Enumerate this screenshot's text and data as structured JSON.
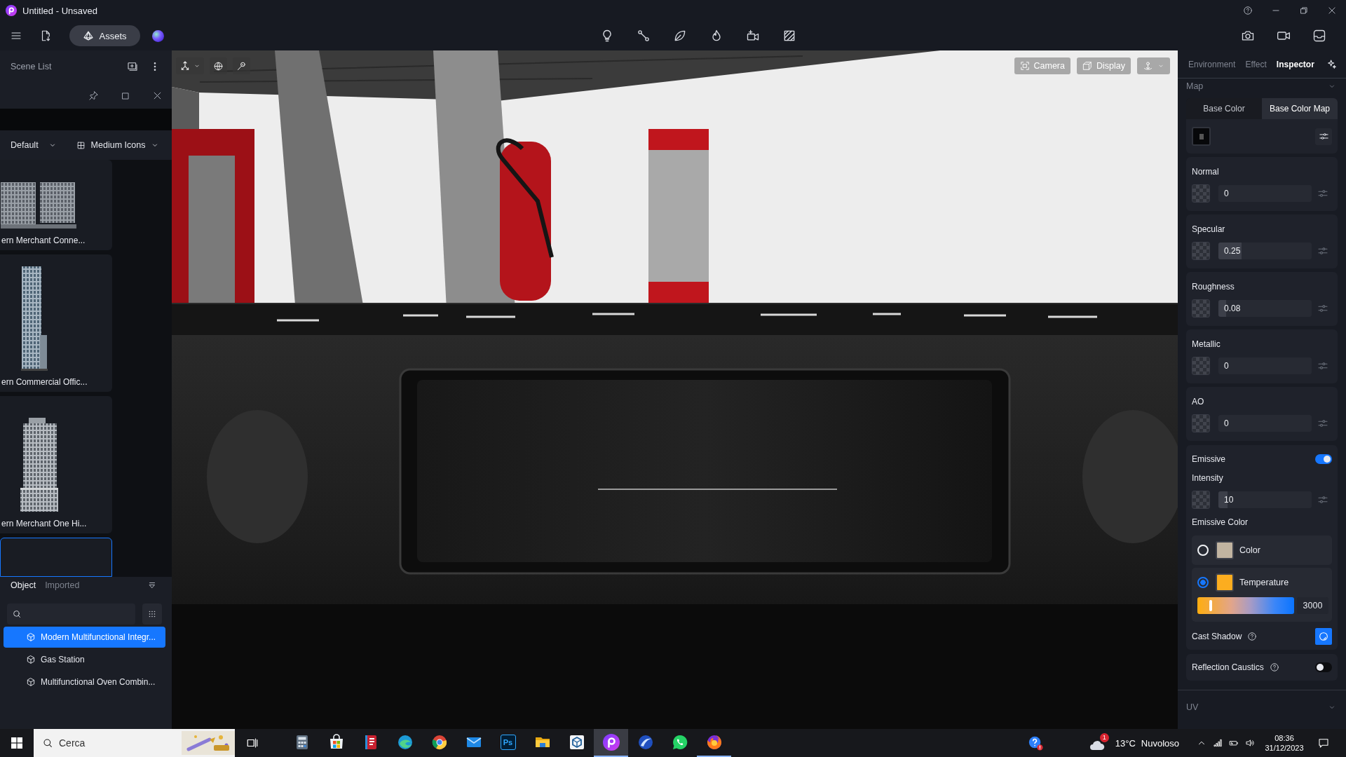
{
  "window": {
    "title": "Untitled - Unsaved"
  },
  "toolbar": {
    "assets_button": "Assets"
  },
  "scene_list": {
    "title": "Scene List"
  },
  "assets_popup": {
    "filter": "Default",
    "view": "Medium Icons",
    "items": [
      {
        "kind": "wide",
        "label": "ern Merchant Conne...",
        "selected": false
      },
      {
        "kind": "slim",
        "label": "ern Commercial Offic...",
        "selected": false
      },
      {
        "kind": "tower",
        "label": "ern Merchant One Hi...",
        "selected": false
      },
      {
        "selected": true
      }
    ]
  },
  "object_panel": {
    "tabs": [
      {
        "label": "Object",
        "selected": true
      },
      {
        "label": "Imported",
        "selected": false
      }
    ],
    "tree": [
      {
        "label": "Modern Multifunctional Integr...",
        "selected": true
      },
      {
        "label": "Gas Station",
        "selected": false
      },
      {
        "label": "Multifunctional Oven Combin...",
        "selected": false
      }
    ]
  },
  "viewport": {
    "camera_button": "Camera",
    "display_button": "Display"
  },
  "inspector": {
    "tabs": [
      {
        "label": "Environment",
        "selected": false
      },
      {
        "label": "Effect",
        "selected": false
      },
      {
        "label": "Inspector",
        "selected": true
      }
    ],
    "map_title": "Map",
    "map_tabs": [
      {
        "label": "Base Color",
        "selected": false
      },
      {
        "label": "Base Color Map",
        "selected": true
      }
    ],
    "properties": [
      {
        "label": "Normal",
        "value": "0"
      },
      {
        "label": "Specular",
        "value": "0.25",
        "level": 0.25
      },
      {
        "label": "Roughness",
        "value": "0.08",
        "level": 0.08
      },
      {
        "label": "Metallic",
        "value": "0"
      },
      {
        "label": "AO",
        "value": "0"
      }
    ],
    "emissive": {
      "label": "Emissive",
      "on": true,
      "intensity_label": "Intensity",
      "intensity": {
        "value": "10",
        "level": 0.1
      },
      "color_label": "Emissive Color",
      "options": [
        {
          "kind": "color",
          "label": "Color",
          "selected": false,
          "color": "#c1b4a1"
        },
        {
          "kind": "temperature",
          "label": "Temperature",
          "selected": true,
          "color": "#fcad1f"
        }
      ],
      "temperature": {
        "level": 0.14,
        "value": "3000"
      },
      "cast_shadow": {
        "label": "Cast Shadow",
        "checked": true
      }
    },
    "reflection_caustics": {
      "label": "Reflection Caustics",
      "on": false
    },
    "uv_title": "UV"
  },
  "taskbar": {
    "search_placeholder": "Cerca",
    "apps": [
      {
        "kind": "calculator",
        "selected": false,
        "running": false
      },
      {
        "kind": "store",
        "selected": false,
        "running": false
      },
      {
        "kind": "reader",
        "selected": false,
        "running": false
      },
      {
        "kind": "wave",
        "selected": false,
        "running": false
      },
      {
        "kind": "ring",
        "selected": false,
        "running": false
      },
      {
        "kind": "mail",
        "selected": false,
        "running": false
      },
      {
        "kind": "lettered",
        "label": "Ps",
        "selected": false,
        "running": false
      },
      {
        "kind": "folder",
        "selected": false,
        "running": false
      },
      {
        "kind": "cube",
        "selected": false,
        "running": false
      },
      {
        "kind": "studio",
        "selected": true,
        "running": true
      },
      {
        "kind": "arc",
        "selected": false,
        "running": false
      },
      {
        "kind": "chat",
        "selected": false,
        "running": false
      },
      {
        "kind": "flame",
        "selected": false,
        "running": true
      }
    ],
    "weather": {
      "badge": "1",
      "temperature": "13°C",
      "condition": "Nuvoloso"
    },
    "clock": {
      "time": "08:36",
      "date": "31/12/2023"
    }
  }
}
